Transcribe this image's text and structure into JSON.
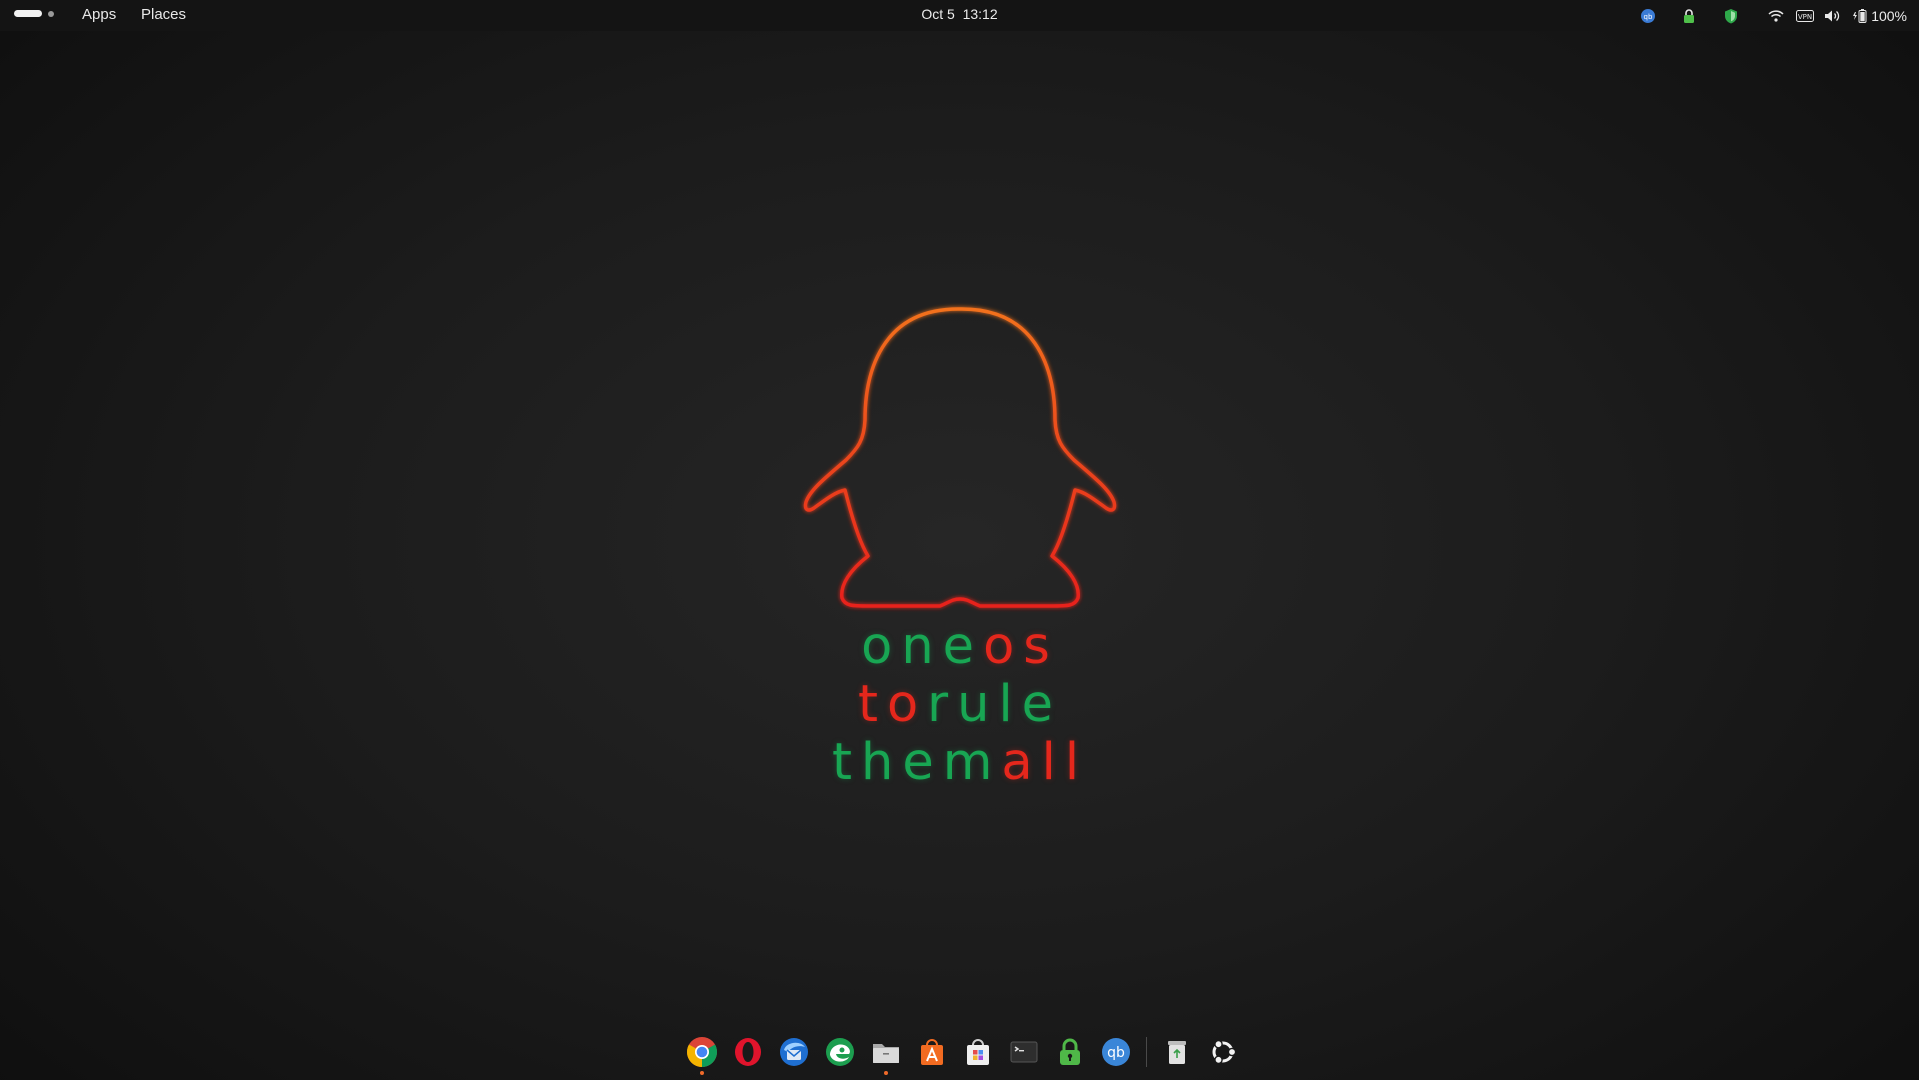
{
  "topbar": {
    "menu": {
      "apps": "Apps",
      "places": "Places"
    },
    "clock": {
      "date": "Oct 5",
      "time": "13:12"
    },
    "tray": {
      "battery_percent": "100%"
    }
  },
  "wallpaper": {
    "lines": [
      [
        {
          "text": "one",
          "color": "green"
        },
        {
          "text": "os",
          "color": "red"
        }
      ],
      [
        {
          "text": "to",
          "color": "red"
        },
        {
          "text": "rule",
          "color": "green"
        }
      ],
      [
        {
          "text": "them",
          "color": "green"
        },
        {
          "text": "all",
          "color": "red"
        }
      ]
    ],
    "colors": {
      "green": "#18a653",
      "red": "#e5271c",
      "orange": "#f2711c"
    }
  },
  "dock": {
    "apps": [
      {
        "name": "chrome",
        "icon": "chrome-icon",
        "running": true
      },
      {
        "name": "opera",
        "icon": "opera-icon",
        "running": false
      },
      {
        "name": "thunderbird",
        "icon": "thunderbird-icon",
        "running": false
      },
      {
        "name": "edge",
        "icon": "edge-icon",
        "running": false
      },
      {
        "name": "files",
        "icon": "folder-icon",
        "running": true
      },
      {
        "name": "app-store",
        "icon": "store-icon",
        "running": false
      },
      {
        "name": "software",
        "icon": "software-bag-icon",
        "running": false
      },
      {
        "name": "terminal",
        "icon": "terminal-icon",
        "running": false
      },
      {
        "name": "vpn",
        "icon": "vpn-lock-icon",
        "running": false
      },
      {
        "name": "qbittorrent",
        "icon": "qbittorrent-icon",
        "running": false
      },
      {
        "name": "trash",
        "icon": "trash-icon",
        "running": false
      },
      {
        "name": "ubuntu",
        "icon": "ubuntu-icon",
        "running": false
      }
    ]
  }
}
